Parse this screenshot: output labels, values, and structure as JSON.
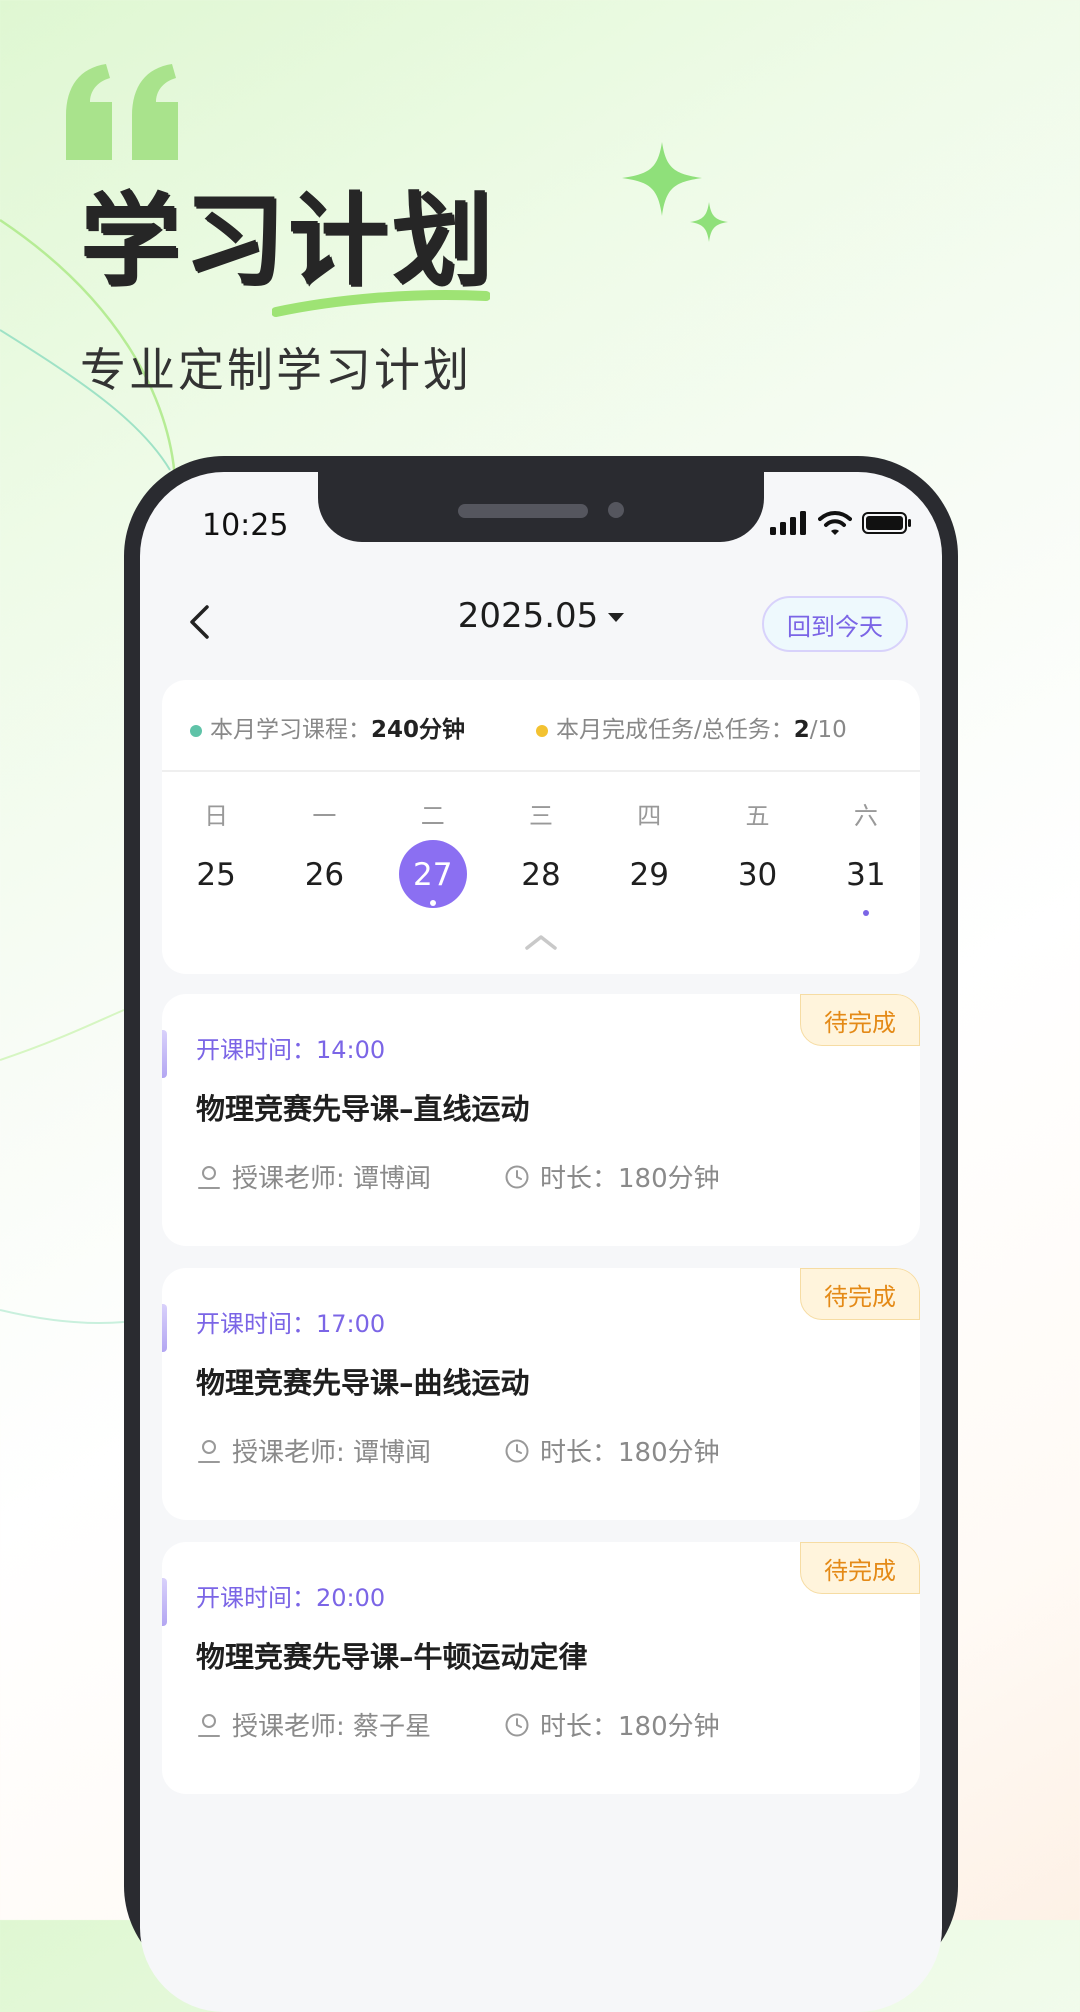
{
  "hero": {
    "title": "学习计划",
    "subtitle": "专业定制学习计划"
  },
  "status_bar": {
    "time": "10:25"
  },
  "nav": {
    "month": "2025.05",
    "today_button": "回到今天"
  },
  "summary": {
    "study_label": "本月学习课程：",
    "study_value": "240分钟",
    "task_label": "本月完成任务/总任务：",
    "task_done": "2",
    "task_total": "/10",
    "study_dot_color": "#5fc3a8",
    "task_dot_color": "#f3c231"
  },
  "calendar": {
    "weekdays": [
      "日",
      "一",
      "二",
      "三",
      "四",
      "五",
      "六"
    ],
    "dates": [
      "25",
      "26",
      "27",
      "28",
      "29",
      "30",
      "31"
    ],
    "selected_date": "27",
    "accent_color": "#8b6ff2"
  },
  "courses": [
    {
      "status": "待完成",
      "start_time": "开课时间：14:00",
      "title": "物理竞赛先导课–直线运动",
      "teacher": "授课老师: 谭博闻",
      "duration": "时长：180分钟"
    },
    {
      "status": "待完成",
      "start_time": "开课时间：17:00",
      "title": "物理竞赛先导课–曲线运动",
      "teacher": "授课老师: 谭博闻",
      "duration": "时长：180分钟"
    },
    {
      "status": "待完成",
      "start_time": "开课时间：20:00",
      "title": "物理竞赛先导课–牛顿运动定律",
      "teacher": "授课老师: 蔡子星",
      "duration": "时长：180分钟"
    }
  ]
}
